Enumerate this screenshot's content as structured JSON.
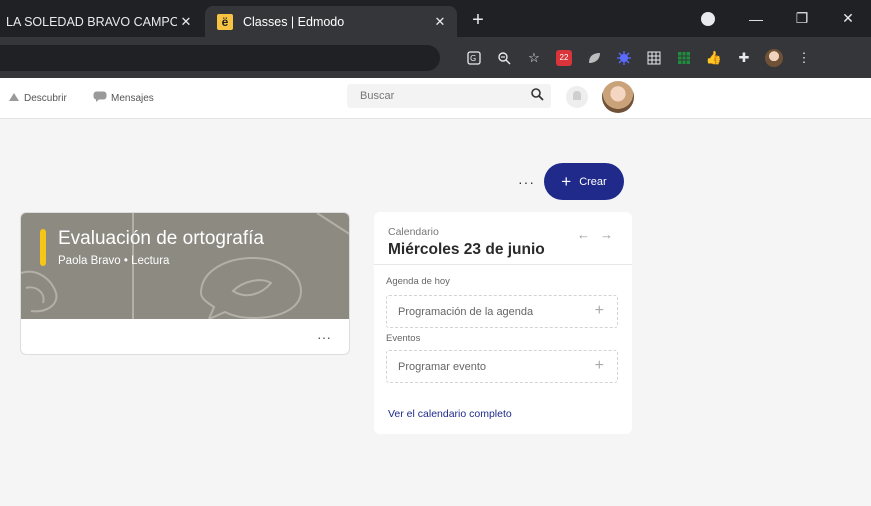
{
  "browser": {
    "tabs": [
      {
        "title": "LA SOLEDAD BRAVO CAMPO",
        "active": false
      },
      {
        "title": "Classes | Edmodo",
        "active": true
      }
    ],
    "favicon_letter": "ë",
    "newtab_label": "+",
    "close_glyph": "✕",
    "minimize_glyph": "—",
    "restore_glyph": "❐",
    "window_close_glyph": "✕",
    "extension_badge": "22",
    "extensions": [
      "translate-icon",
      "zoom-icon",
      "star-icon",
      "abp-icon",
      "leaf-icon",
      "virus-icon",
      "grid-icon",
      "sheets-icon",
      "thumbs-up-icon",
      "puzzle-icon",
      "profile-icon",
      "menu-icon"
    ]
  },
  "header": {
    "nav": [
      {
        "label": "Descubrir",
        "icon": "discover-icon"
      },
      {
        "label": "Mensajes",
        "icon": "messages-icon"
      }
    ],
    "search_placeholder": "Buscar"
  },
  "main": {
    "more_label": "···",
    "create_label": "Crear",
    "create_plus": "+"
  },
  "class_card": {
    "title": "Evaluación de ortografía",
    "subtitle": "Paola Bravo • Lectura",
    "more_label": "···",
    "accent_color": "#f5c518"
  },
  "calendar": {
    "label": "Calendario",
    "date": "Miércoles 23 de junio",
    "prev_arrow": "←",
    "next_arrow": "→",
    "today_label": "Agenda de hoy",
    "agenda_placeholder": "Programación de la agenda",
    "events_label": "Eventos",
    "event_placeholder": "Programar evento",
    "plus": "+",
    "full_link": "Ver el calendario completo"
  },
  "colors": {
    "brand": "#1f2a8a",
    "chrome_dark": "#202124",
    "chrome_tab": "#35363a"
  }
}
